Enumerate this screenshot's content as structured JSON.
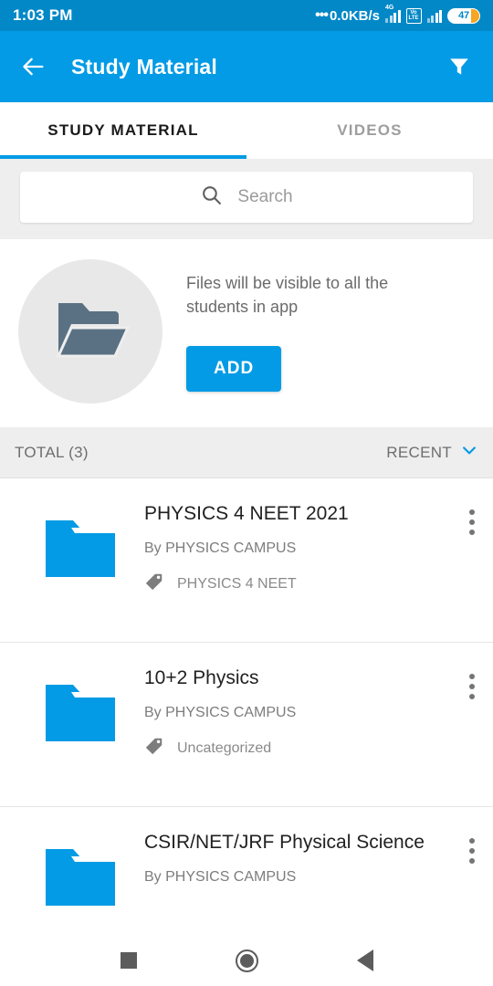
{
  "status_bar": {
    "time": "1:03 PM",
    "network_speed": "0.0KB/s",
    "speed_prefix": "•••",
    "network_type": "4G",
    "volte_top": "Vo",
    "volte_bottom": "LTE",
    "battery_percent": "47"
  },
  "app_bar": {
    "title": "Study Material",
    "back_icon": "arrow-left-icon",
    "filter_icon": "filter-funnel-icon",
    "background_color": "#039be5"
  },
  "tabs": [
    {
      "label": "STUDY MATERIAL",
      "active": true
    },
    {
      "label": "VIDEOS",
      "active": false
    }
  ],
  "search": {
    "placeholder": "Search",
    "icon": "search-icon"
  },
  "promo": {
    "icon": "open-folder-icon",
    "text": "Files will be visible to all the students in app",
    "add_label": "ADD",
    "accent_color": "#039be5"
  },
  "list_header": {
    "total_label": "TOTAL (3)",
    "sort_label": "RECENT",
    "sort_icon": "chevron-down-icon"
  },
  "items": [
    {
      "icon": "folder-icon",
      "title": "PHYSICS 4 NEET 2021",
      "author": "By PHYSICS CAMPUS",
      "tag": "PHYSICS 4 NEET",
      "menu_icon": "more-vertical-icon"
    },
    {
      "icon": "folder-icon",
      "title": "10+2 Physics",
      "author": "By PHYSICS CAMPUS",
      "tag": "Uncategorized",
      "menu_icon": "more-vertical-icon"
    },
    {
      "icon": "folder-icon",
      "title": "CSIR/NET/JRF Physical Science",
      "author": "By PHYSICS CAMPUS",
      "tag": "",
      "menu_icon": "more-vertical-icon"
    }
  ],
  "nav_bar": {
    "recents_icon": "square-recents-icon",
    "home_icon": "circle-home-icon",
    "back_icon": "triangle-back-icon"
  }
}
